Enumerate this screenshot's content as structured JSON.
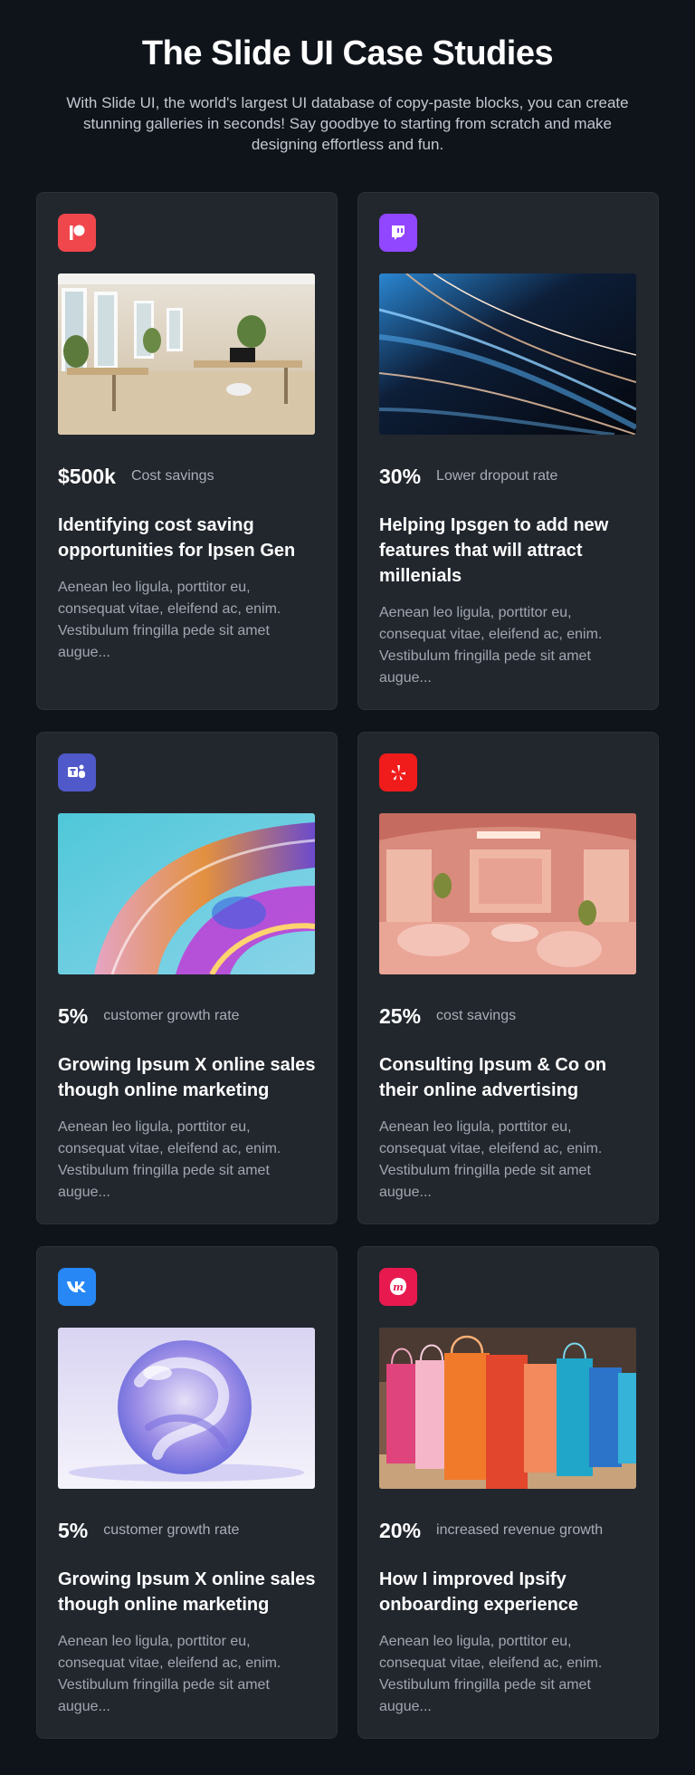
{
  "header": {
    "title": "The Slide UI Case Studies",
    "subtitle": "With Slide UI, the world's largest UI database of copy-paste blocks, you can create stunning galleries in seconds! Say goodbye to starting from scratch and make designing effortless and fun."
  },
  "cards": [
    {
      "brand_icon": "patreon-icon",
      "brand_color": "#f0474c",
      "image": "office-interior-image",
      "stat_value": "$500k",
      "stat_label": "Cost savings",
      "title": "Identifying cost saving opportunities for Ipsen Gen",
      "description": "Aenean leo ligula, porttitor eu, consequat vitae, eleifend ac, enim. Vestibulum fringilla pede sit amet augue..."
    },
    {
      "brand_icon": "twitch-icon",
      "brand_color": "#9146ff",
      "image": "light-streaks-image",
      "stat_value": "30%",
      "stat_label": "Lower dropout rate",
      "title": "Helping Ipsgen to add new features that will attract millenials",
      "description": "Aenean leo ligula, porttitor eu, consequat vitae, eleifend ac, enim. Vestibulum fringilla pede sit amet augue..."
    },
    {
      "brand_icon": "teams-icon",
      "brand_color": "#5059c9",
      "image": "iridescent-wave-image",
      "stat_value": "5%",
      "stat_label": "customer growth rate",
      "title": "Growing Ipsum X online sales though online marketing",
      "description": "Aenean leo ligula, porttitor eu, consequat vitae, eleifend ac, enim. Vestibulum fringilla pede sit amet augue..."
    },
    {
      "brand_icon": "yelp-icon",
      "brand_color": "#f01c1c",
      "image": "pink-store-interior-image",
      "stat_value": "25%",
      "stat_label": "cost savings",
      "title": "Consulting Ipsum & Co on their online advertising",
      "description": "Aenean leo ligula, porttitor eu, consequat vitae, eleifend ac, enim. Vestibulum fringilla pede sit amet augue..."
    },
    {
      "brand_icon": "vk-icon",
      "brand_color": "#2787f5",
      "image": "glass-sphere-image",
      "stat_value": "5%",
      "stat_label": "customer growth rate",
      "title": "Growing Ipsum X online sales though online marketing",
      "description": "Aenean leo ligula, porttitor eu, consequat vitae, eleifend ac, enim. Vestibulum fringilla pede sit amet augue..."
    },
    {
      "brand_icon": "meetup-icon",
      "brand_color": "#e8194e",
      "image": "shopping-bags-image",
      "stat_value": "20%",
      "stat_label": "increased revenue growth",
      "title": "How I improved Ipsify onboarding experience",
      "description": "Aenean leo ligula, porttitor eu, consequat vitae, eleifend ac, enim. Vestibulum fringilla pede sit amet augue..."
    }
  ]
}
